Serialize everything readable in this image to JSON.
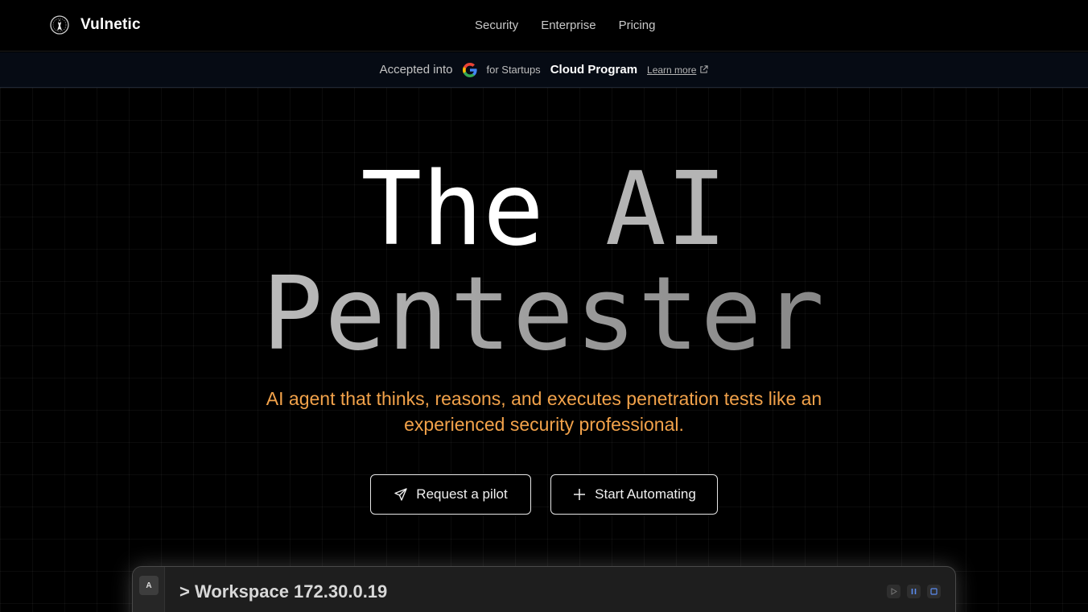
{
  "nav": {
    "brand": "Vulnetic",
    "links": [
      "Security",
      "Enterprise",
      "Pricing"
    ]
  },
  "announcement": {
    "prefix": "Accepted into",
    "startups": "for Startups",
    "program": "Cloud Program",
    "link": "Learn more"
  },
  "hero": {
    "title_the": "The",
    "title_ai": "AI",
    "title_line2": "Pentester",
    "subtitle": "AI agent that thinks, reasons, and executes penetration tests like an experienced security professional.",
    "accent_color": "#f2a24a"
  },
  "buttons": {
    "pilot": "Request a pilot",
    "automate": "Start Automating"
  },
  "workspace": {
    "avatar": "A",
    "title": "> Workspace 172.30.0.19"
  },
  "icons": {
    "logo": "vulnetic-emblem-icon",
    "google": "google-g-icon",
    "external": "external-link-icon",
    "send": "send-icon",
    "plus": "plus-icon",
    "play": "play-icon",
    "pause": "pause-icon",
    "stop": "stop-icon"
  }
}
